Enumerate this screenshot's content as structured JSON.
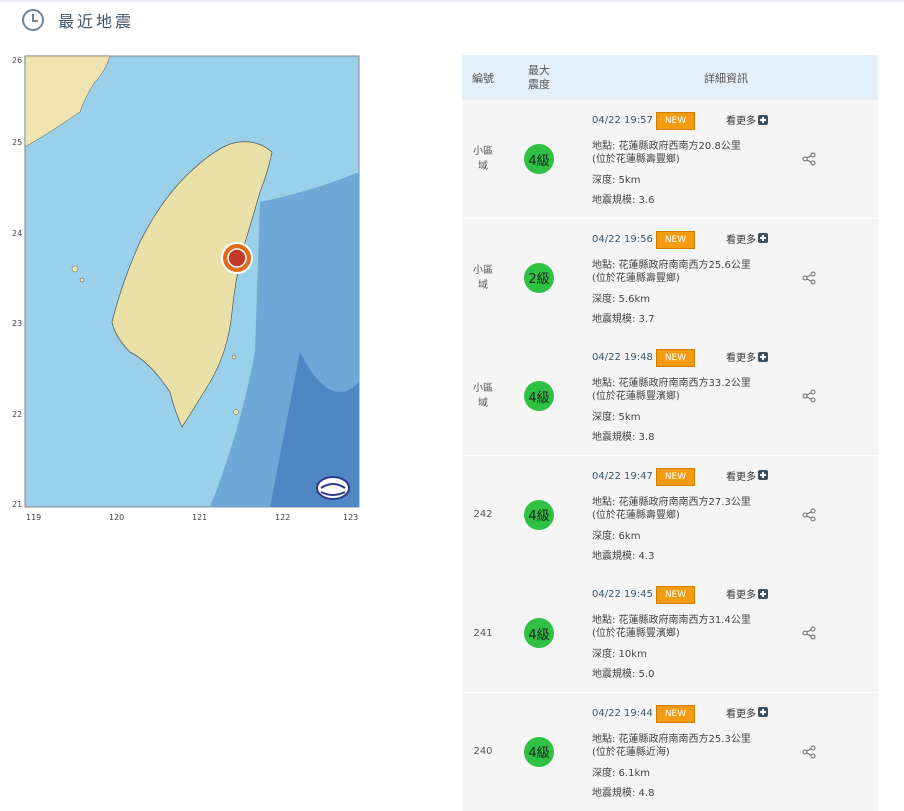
{
  "page": {
    "title": "最近地震"
  },
  "map": {
    "y_labels": [
      "26",
      "25",
      "24",
      "23",
      "22",
      "21"
    ],
    "x_labels": [
      "119",
      "120",
      "121",
      "122",
      "123"
    ]
  },
  "table": {
    "headers": {
      "no": "編號",
      "intensity": "最大\n震度",
      "detail": "詳細資訊"
    },
    "new_label": "NEW",
    "more_label": "看更多",
    "rows": [
      {
        "no": "小區\n域",
        "intensity": "4級",
        "color": "#2ec143",
        "time": "04/22 19:57",
        "loc1": "地點: 花蓮縣政府西南方20.8公里",
        "loc2": "(位於花蓮縣壽豐鄉)",
        "depth": "深度: 5km",
        "mag": "地震規模: 3.6"
      },
      {
        "no": "小區\n域",
        "intensity": "2級",
        "color": "#2ec143",
        "time": "04/22 19:56",
        "loc1": "地點: 花蓮縣政府南南西方25.6公里",
        "loc2": "(位於花蓮縣壽豐鄉)",
        "depth": "深度: 5.6km",
        "mag": "地震規模: 3.7"
      },
      {
        "no": "小區\n域",
        "intensity": "4級",
        "color": "#2ec143",
        "time": "04/22 19:48",
        "loc1": "地點: 花蓮縣政府南南西方33.2公里",
        "loc2": "(位於花蓮縣豐濱鄉)",
        "depth": "深度: 5km",
        "mag": "地震規模: 3.8"
      },
      {
        "no": "242",
        "intensity": "4級",
        "color": "#2ec143",
        "time": "04/22 19:47",
        "loc1": "地點: 花蓮縣政府南南西方27.3公里",
        "loc2": "(位於花蓮縣壽豐鄉)",
        "depth": "深度: 6km",
        "mag": "地震規模: 4.3"
      },
      {
        "no": "241",
        "intensity": "4級",
        "color": "#2ec143",
        "time": "04/22 19:45",
        "loc1": "地點: 花蓮縣政府南南西方31.4公里",
        "loc2": "(位於花蓮縣豐濱鄉)",
        "depth": "深度: 10km",
        "mag": "地震規模: 5.0"
      },
      {
        "no": "240",
        "intensity": "4級",
        "color": "#2ec143",
        "time": "04/22 19:44",
        "loc1": "地點: 花蓮縣政府南南西方25.3公里",
        "loc2": "(位於花蓮縣近海)",
        "depth": "深度: 6.1km",
        "mag": "地震規模: 4.8"
      }
    ]
  }
}
